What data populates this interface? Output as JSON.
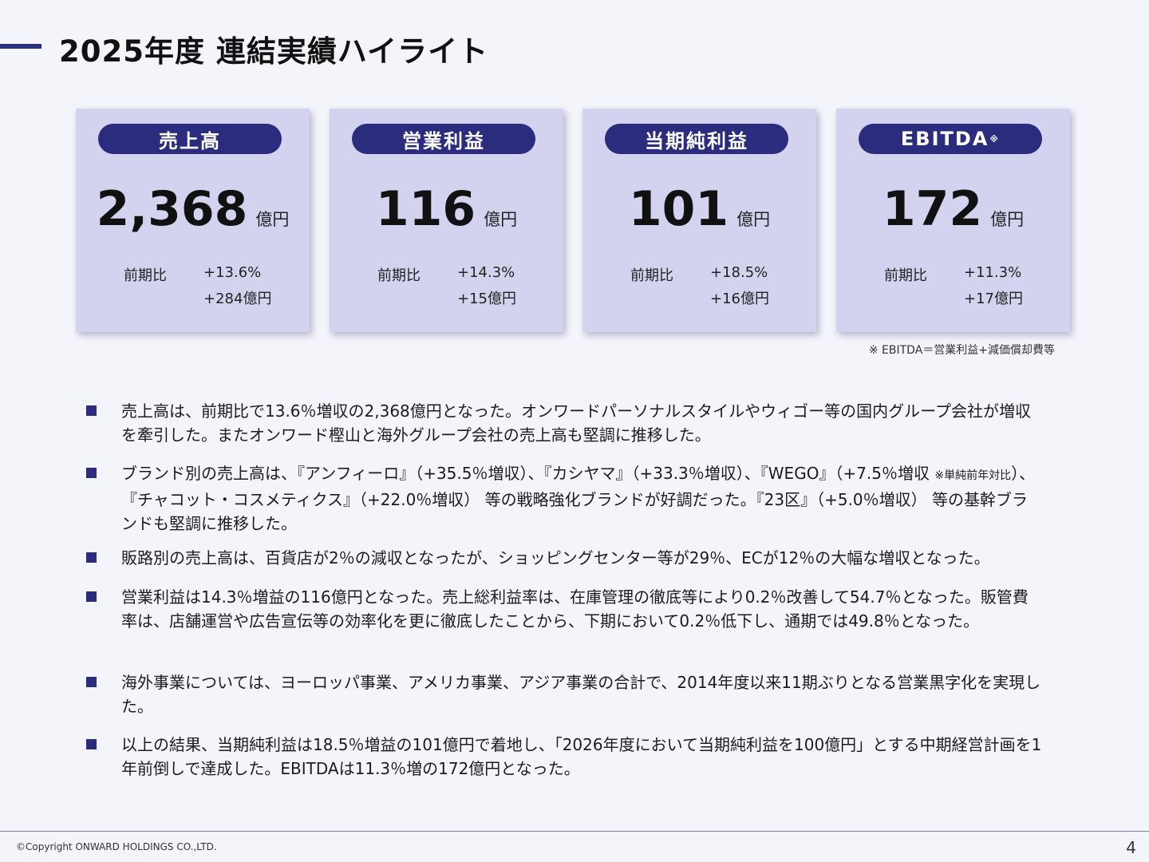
{
  "header": {
    "title": "2025年度 連結実績ハイライト"
  },
  "cards": [
    {
      "label": "売上高",
      "value": "2,368",
      "unit": "億円",
      "compare_label": "前期比",
      "change_pct": "+13.6%",
      "change_abs": "+284億円"
    },
    {
      "label": "営業利益",
      "value": "116",
      "unit": "億円",
      "compare_label": "前期比",
      "change_pct": "+14.3%",
      "change_abs": "+15億円"
    },
    {
      "label": "当期純利益",
      "value": "101",
      "unit": "億円",
      "compare_label": "前期比",
      "change_pct": "+18.5%",
      "change_abs": "+16億円"
    },
    {
      "label": "EBITDA",
      "label_mark": "※",
      "value": "172",
      "unit": "億円",
      "compare_label": "前期比",
      "change_pct": "+11.3%",
      "change_abs": "+17億円"
    }
  ],
  "footnote": "※ EBITDA＝営業利益+減価償却費等",
  "bullets": [
    {
      "text": "売上高は、前期比で13.6％増収の2,368億円となった。オンワードパーソナルスタイルやウィゴー等の国内グループ会社が増収を牽引した。またオンワード樫山と海外グループ会社の売上高も堅調に推移した。"
    },
    {
      "text_a": "ブランド別の売上高は、『アンフィーロ』（+35.5％増収）、『カシヤマ』（+33.3％増収）、『WEGO』（+7.5％増収 ",
      "note": "※単純前年対比",
      "text_b": "）、『チャコット・コスメティクス』（+22.0％増収） 等の戦略強化ブランドが好調だった。『23区』（+5.0％増収） 等の基幹ブランドも堅調に推移した。"
    },
    {
      "text": "販路別の売上高は、百貨店が2％の減収となったが、ショッピングセンター等が29％、ECが12％の大幅な増収となった。"
    },
    {
      "text": "営業利益は14.3％増益の116億円となった。売上総利益率は、在庫管理の徹底等により0.2％改善して54.7％となった。販管費率は、店舗運営や広告宣伝等の効率化を更に徹底したことから、下期において0.2％低下し、通期では49.8％となった。"
    },
    {
      "text": "海外事業については、ヨーロッパ事業、アメリカ事業、アジア事業の合計で、2014年度以来11期ぶりとなる営業黒字化を実現した。"
    },
    {
      "text": "以上の結果、当期純利益は18.5％増益の101億円で着地し、「2026年度において当期純利益を100億円」とする中期経営計画を1年前倒しで達成した。EBITDAは11.3％増の172億円となった。"
    }
  ],
  "footer": {
    "copyright": "©Copyright ONWARD HOLDINGS CO.,LTD.",
    "page_number": "4"
  }
}
